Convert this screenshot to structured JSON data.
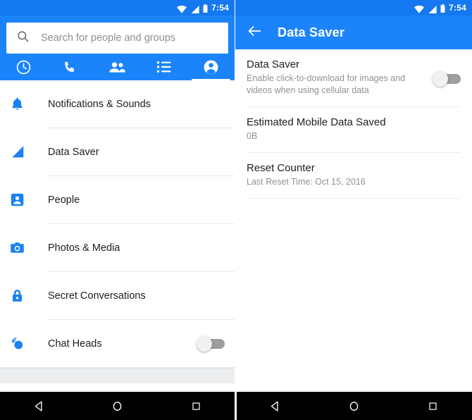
{
  "status_bar": {
    "time": "7:54",
    "icons": [
      "wifi-icon",
      "cellular-signal-icon",
      "battery-icon"
    ]
  },
  "left_panel": {
    "search": {
      "placeholder": "Search for people and groups",
      "icon": "search-icon"
    },
    "tabs": [
      {
        "name": "recents",
        "icon": "clock-icon",
        "selected": false
      },
      {
        "name": "calls",
        "icon": "phone-icon",
        "selected": false
      },
      {
        "name": "groups",
        "icon": "people-group-icon",
        "selected": false
      },
      {
        "name": "list",
        "icon": "list-icon",
        "selected": false
      },
      {
        "name": "profile",
        "icon": "account-circle-icon",
        "selected": true
      }
    ],
    "items": [
      {
        "label": "Notifications & Sounds",
        "icon": "bell-icon",
        "toggle": null
      },
      {
        "label": "Data Saver",
        "icon": "data-saver-signal-icon",
        "toggle": null
      },
      {
        "label": "People",
        "icon": "person-badge-icon",
        "toggle": null
      },
      {
        "label": "Photos & Media",
        "icon": "camera-icon",
        "toggle": null
      },
      {
        "label": "Secret Conversations",
        "icon": "lock-icon",
        "toggle": null
      },
      {
        "label": "Chat Heads",
        "icon": "chat-heads-icon",
        "toggle": "off"
      }
    ]
  },
  "right_panel": {
    "header": {
      "back_icon": "back-arrow-icon",
      "title": "Data Saver"
    },
    "rows": [
      {
        "title": "Data Saver",
        "subtitle": "Enable click-to-download for images and videos when using cellular data",
        "toggle": "off"
      },
      {
        "title": "Estimated Mobile Data Saved",
        "subtitle": "0B",
        "toggle": null
      },
      {
        "title": "Reset Counter",
        "subtitle": "Last Reset Time: Oct 15, 2016",
        "toggle": null
      }
    ]
  },
  "nav_bar": {
    "buttons": [
      {
        "name": "back-nav-button",
        "icon": "triangle-back-icon"
      },
      {
        "name": "home-nav-button",
        "icon": "circle-home-icon"
      },
      {
        "name": "recents-nav-button",
        "icon": "square-recents-icon"
      }
    ]
  },
  "colors": {
    "brand_blue": "#1c84fb",
    "status_blue": "#1478f0",
    "icon_blue": "#1a82f0",
    "text_primary": "#1d1d1d",
    "text_secondary": "#919191",
    "nav_black": "#000000"
  }
}
